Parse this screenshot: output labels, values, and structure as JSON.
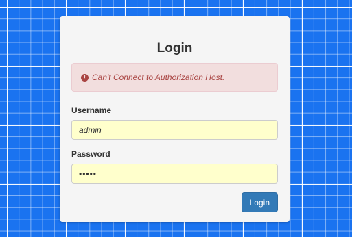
{
  "login": {
    "title": "Login",
    "error_icon": "!",
    "error_message": "Can't Connect to Authorization Host.",
    "username_label": "Username",
    "username_value": "admin",
    "password_label": "Password",
    "password_value": "•••••",
    "submit_label": "Login"
  },
  "colors": {
    "background": "#1a73f0",
    "panel": "#f5f5f5",
    "alert_bg": "#f2dede",
    "alert_text": "#a94442",
    "input_bg": "#ffffcc",
    "button": "#337ab7"
  }
}
